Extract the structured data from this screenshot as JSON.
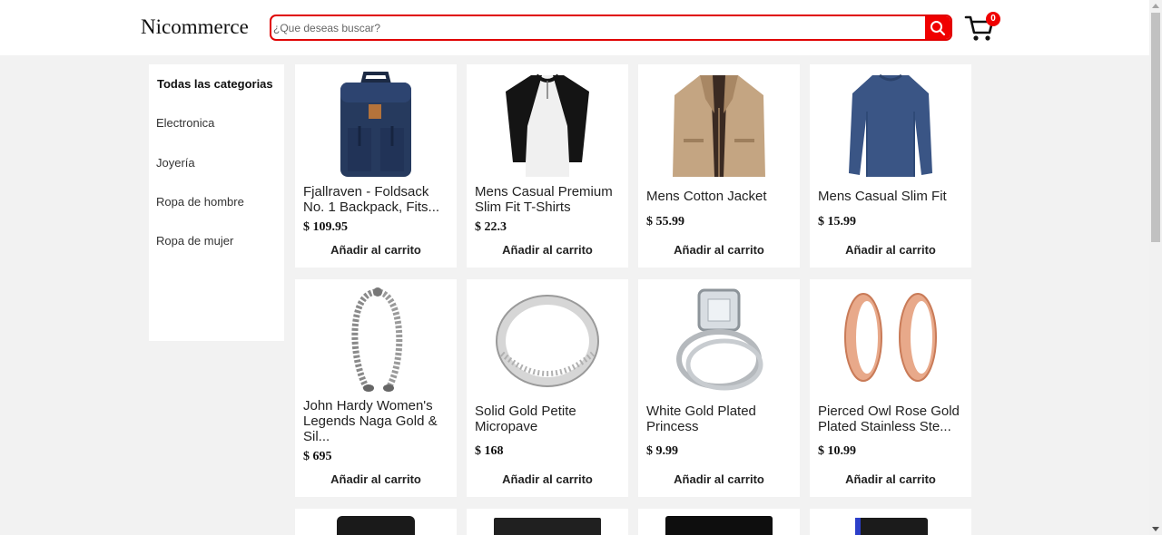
{
  "header": {
    "logo": "Nicommerce",
    "search_placeholder": "¿Que deseas buscar?",
    "cart_count": "0"
  },
  "sidebar": {
    "title": "Todas las categorias",
    "categories": [
      "Electronica",
      "Joyería",
      "Ropa de hombre",
      "Ropa de mujer"
    ]
  },
  "add_to_cart_label": "Añadir al carrito",
  "products": [
    {
      "name": "Fjallraven - Foldsack No. 1 Backpack, Fits...",
      "price": "$ 109.95",
      "image": "backpack"
    },
    {
      "name": "Mens Casual Premium Slim Fit T-Shirts",
      "price": "$ 22.3",
      "image": "raglan-shirt"
    },
    {
      "name": "Mens Cotton Jacket",
      "price": "$ 55.99",
      "image": "jacket"
    },
    {
      "name": "Mens Casual Slim Fit",
      "price": "$ 15.99",
      "image": "longsleeve-shirt"
    },
    {
      "name": "John Hardy Women's Legends Naga Gold & Sil...",
      "price": "$ 695",
      "image": "bracelet"
    },
    {
      "name": "Solid Gold Petite Micropave",
      "price": "$ 168",
      "image": "silver-ring"
    },
    {
      "name": "White Gold Plated Princess",
      "price": "$ 9.99",
      "image": "diamond-ring"
    },
    {
      "name": "Pierced Owl Rose Gold Plated Stainless Ste...",
      "price": "$ 10.99",
      "image": "rose-gold-plugs"
    }
  ],
  "colors": {
    "accent": "#f00000",
    "background": "#f2f2f2",
    "card": "#ffffff"
  }
}
